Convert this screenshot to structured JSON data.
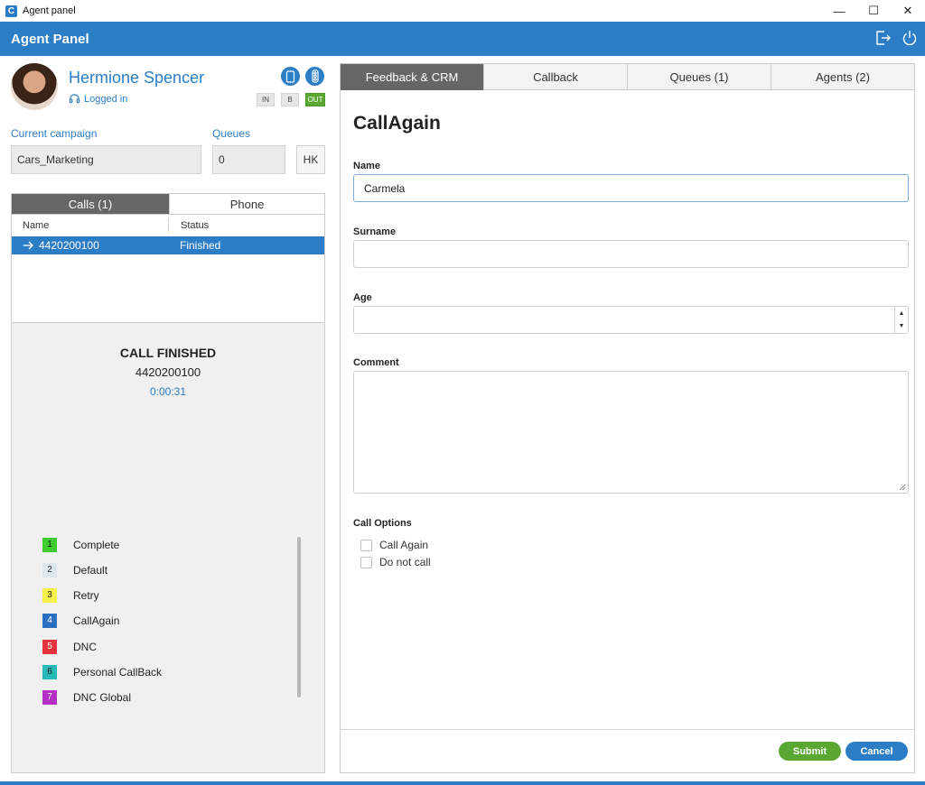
{
  "window": {
    "title": "Agent panel",
    "app_icon_letter": "C",
    "minimize": "—",
    "maximize": "☐",
    "close": "✕"
  },
  "header": {
    "title": "Agent Panel"
  },
  "agent": {
    "name": "Hermione Spencer",
    "status": "Logged in",
    "modes": [
      "IN",
      "B",
      "OUT"
    ],
    "active_mode": "OUT"
  },
  "campaign": {
    "label": "Current campaign",
    "value": "Cars_Marketing",
    "queues_label": "Queues",
    "queues_value": "0",
    "hk_label": "HK"
  },
  "left_tabs": {
    "calls": "Calls (1)",
    "phone": "Phone"
  },
  "calls_table": {
    "col_name": "Name",
    "col_status": "Status",
    "rows": [
      {
        "name": "4420200100",
        "status": "Finished"
      }
    ]
  },
  "call_state": {
    "title": "CALL FINISHED",
    "number": "4420200100",
    "duration": "0:00:31"
  },
  "dispositions": [
    {
      "num": "1",
      "label": "Complete",
      "color": "#3fcc2f"
    },
    {
      "num": "2",
      "label": "Default",
      "color": "#dde7ee"
    },
    {
      "num": "3",
      "label": "Retry",
      "color": "#f2f24a"
    },
    {
      "num": "4",
      "label": "CallAgain",
      "color": "#2b6fbf"
    },
    {
      "num": "5",
      "label": "DNC",
      "color": "#e6323c"
    },
    {
      "num": "6",
      "label": "Personal CallBack",
      "color": "#27b8b8"
    },
    {
      "num": "7",
      "label": "DNC Global",
      "color": "#b62fc4"
    }
  ],
  "right_tabs": [
    "Feedback & CRM",
    "Callback",
    "Queues (1)",
    "Agents (2)"
  ],
  "active_right_tab": "Feedback & CRM",
  "form": {
    "title": "CallAgain",
    "name_label": "Name",
    "name_value": "Carmela",
    "surname_label": "Surname",
    "surname_value": "",
    "age_label": "Age",
    "age_value": "",
    "comment_label": "Comment",
    "call_options_label": "Call Options",
    "options": [
      "Call Again",
      "Do not call"
    ],
    "submit": "Submit",
    "cancel": "Cancel"
  },
  "colors": {
    "brand_blue": "#2b7dc6",
    "submit_green": "#5aa832",
    "tab_active": "#666666"
  }
}
